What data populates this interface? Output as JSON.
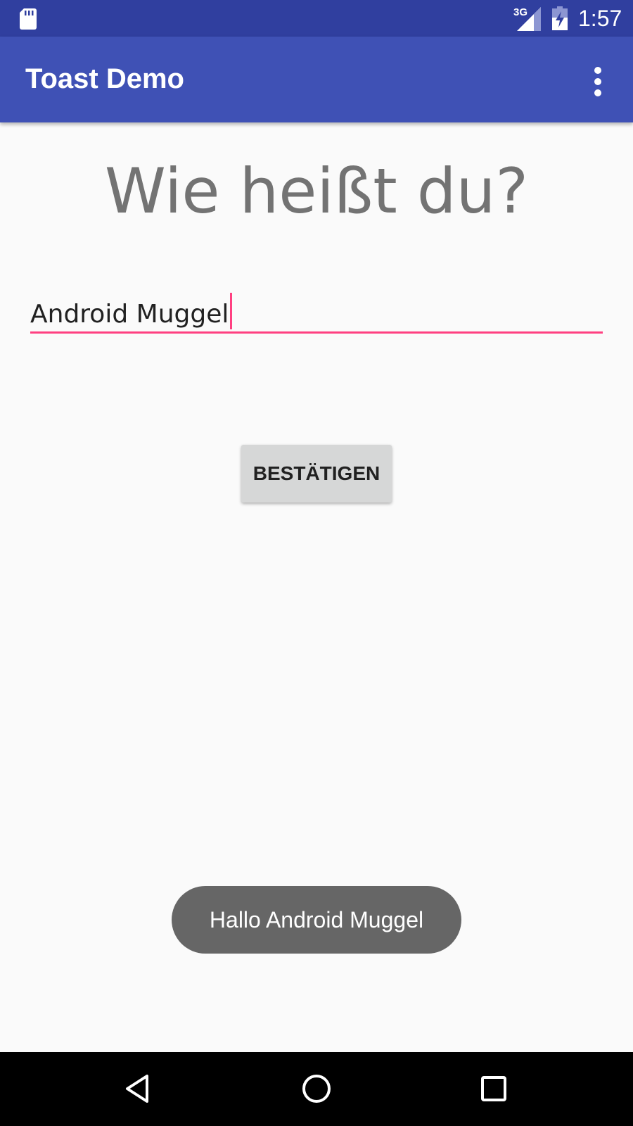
{
  "status_bar": {
    "network": "3G",
    "time": "1:57",
    "icons": [
      "sd-card-icon",
      "signal-icon",
      "battery-charging-icon"
    ]
  },
  "app_bar": {
    "title": "Toast Demo",
    "overflow_icon": "more-vert-icon"
  },
  "main": {
    "heading": "Wie heißt du?",
    "name_input": {
      "value": "Android Muggel"
    },
    "confirm_button_label": "BESTÄTIGEN"
  },
  "toast": {
    "message": "Hallo Android Muggel"
  },
  "nav_bar": {
    "icons": [
      "back-icon",
      "home-icon",
      "recents-icon"
    ]
  },
  "colors": {
    "status_bar": "#303f9f",
    "app_bar": "#3f51b5",
    "accent": "#ff4081",
    "background": "#fafafa",
    "toast": "#666666",
    "button": "#d6d7d7"
  }
}
